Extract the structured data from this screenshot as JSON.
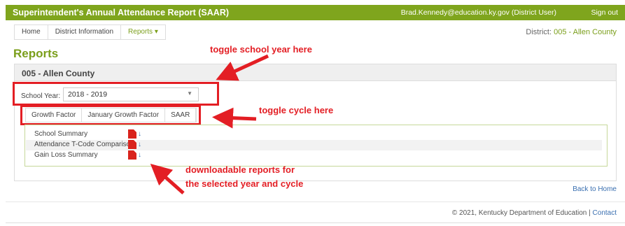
{
  "header": {
    "title": "Superintendent's Annual Attendance Report (SAAR)",
    "user": "Brad.Kennedy@education.ky.gov (District User)",
    "signout": "Sign out",
    "bg_color": "#7fa51d"
  },
  "nav": {
    "items": [
      {
        "label": "Home"
      },
      {
        "label": "District Information"
      },
      {
        "label": "Reports ▾"
      }
    ],
    "district_prefix": "District:",
    "district_value": "005 - Allen County"
  },
  "page": {
    "heading": "Reports",
    "panel_title": "005 - Allen County",
    "school_year_label": "School Year:",
    "school_year_value": "2018 - 2019",
    "tabs": [
      {
        "label": "Growth Factor"
      },
      {
        "label": "January Growth Factor"
      },
      {
        "label": "SAAR"
      }
    ],
    "reports": [
      {
        "label": "School Summary"
      },
      {
        "label": "Attendance T-Code Comparison"
      },
      {
        "label": "Gain Loss Summary"
      }
    ],
    "pdf_icon": "pdf-icon",
    "download_icon": "download-arrow-icon"
  },
  "annotations": {
    "year": "toggle school year here",
    "cycle": "toggle cycle here",
    "reports_line1": "downloadable reports for",
    "reports_line2": "the selected year and cycle",
    "color": "#e31e24"
  },
  "footer": {
    "back_home": "Back to Home",
    "copyright": "© 2021, Kentucky Department of Education |",
    "contact": "Contact"
  }
}
